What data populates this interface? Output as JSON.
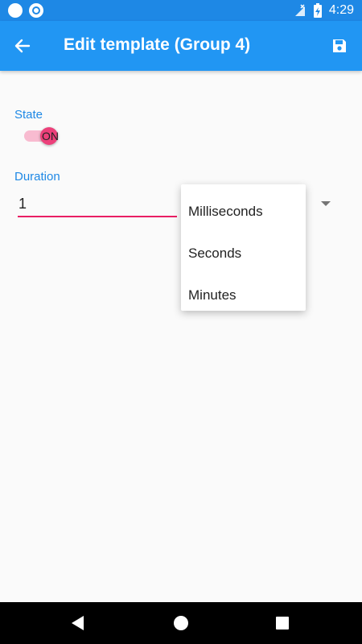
{
  "status_bar": {
    "time": "4:29"
  },
  "app_bar": {
    "title": "Edit template (Group 4)",
    "back_icon": "arrow-back-icon",
    "save_icon": "save-icon"
  },
  "form": {
    "state_label": "State",
    "state_switch_text": "ON",
    "duration_label": "Duration",
    "duration_value": "1"
  },
  "unit_menu": {
    "options": [
      "Milliseconds",
      "Seconds",
      "Minutes"
    ]
  },
  "colors": {
    "primary": "#2196f3",
    "accent": "#e91e63"
  }
}
